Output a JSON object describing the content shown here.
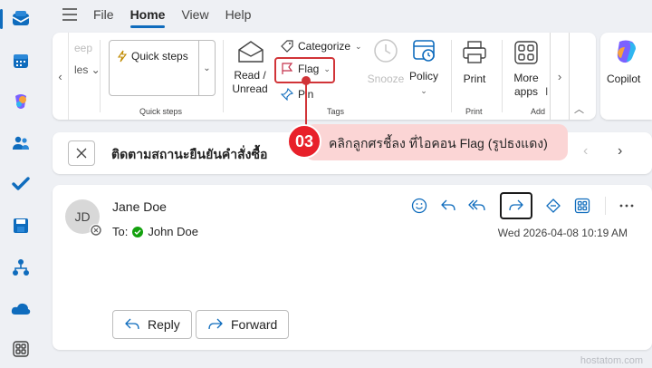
{
  "menu": {
    "tabs": [
      "File",
      "Home",
      "View",
      "Help"
    ],
    "active_tab": "Home"
  },
  "ribbon": {
    "faded_left_top": "eep",
    "faded_left_bottom": "les",
    "quick_steps_label": "Quick steps",
    "quick_steps_group": "Quick steps",
    "read_unread": "Read / Unread",
    "categorize": "Categorize",
    "flag": "Flag",
    "pin": "Pin",
    "tags_group": "Tags",
    "snooze": "Snooze",
    "policy": "Policy",
    "print": "Print",
    "print_group": "Print",
    "more_apps": "More apps",
    "add_group": "Add",
    "faded_right": "I",
    "copilot": "Copilot"
  },
  "subject": {
    "title": "ติดตามสถานะยืนยันคำสั่งซื้อ"
  },
  "callout": {
    "number": "03",
    "text": "คลิกลูกศรชี้ลง ที่ไอคอน Flag (รูปธงแดง)"
  },
  "message": {
    "avatar_initials": "JD",
    "sender": "Jane Doe",
    "to_label": "To:",
    "recipient": "John Doe",
    "date": "Wed 2026-04-08 10:19 AM",
    "reply_label": "Reply",
    "forward_label": "Forward"
  },
  "watermark": "hostatom.com",
  "colors": {
    "accent": "#0f6cbd",
    "highlight": "#d13438",
    "callout_bg": "#fbd5d5",
    "callout_badge": "#e8202a"
  }
}
